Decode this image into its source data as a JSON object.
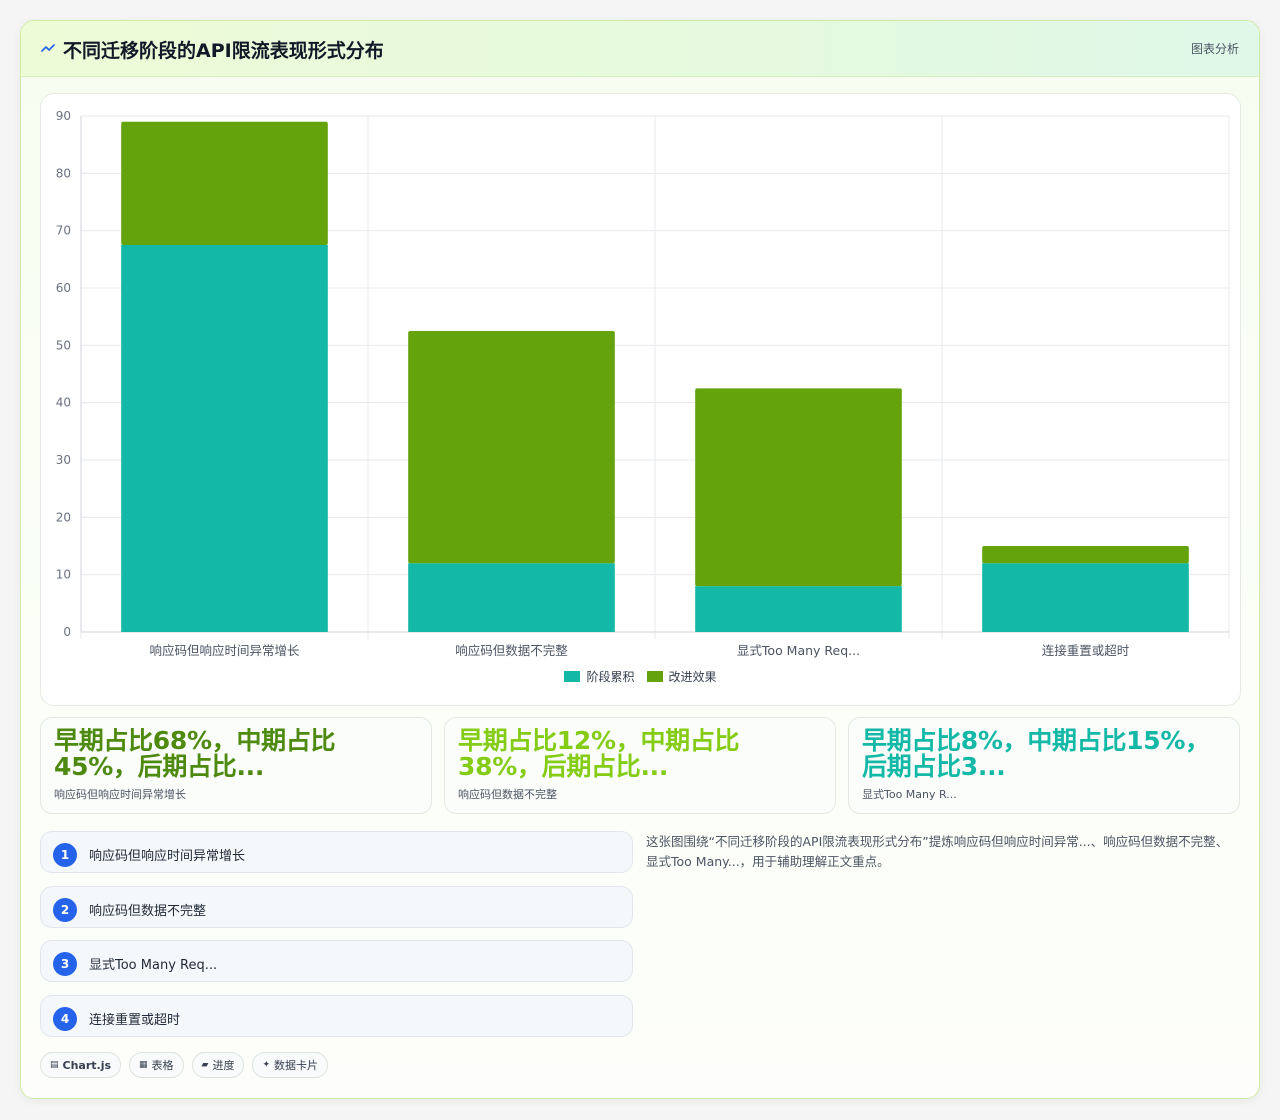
{
  "header": {
    "title": "不同迁移阶段的API限流表现形式分布",
    "right_label": "图表分析"
  },
  "chart_data": {
    "type": "bar",
    "stacked": true,
    "categories": [
      "响应码但响应时间异常增长",
      "响应码但数据不完整",
      "显式Too Many Req...",
      "连接重置或超时"
    ],
    "series": [
      {
        "name": "阶段累积",
        "values": [
          67.5,
          12,
          8,
          12
        ],
        "color": "#14b8a6"
      },
      {
        "name": "改进效果",
        "values": [
          21.5,
          40.5,
          34.5,
          3
        ],
        "color": "#65a30d"
      }
    ],
    "ylim": [
      0,
      90
    ],
    "yticks": [
      0,
      10,
      20,
      30,
      40,
      50,
      60,
      70,
      80,
      90
    ],
    "grid": true,
    "legend_position": "bottom"
  },
  "stats": [
    {
      "value": "早期占比68%，中期占比45%，后期占比...",
      "label": "响应码但响应时间异常增长",
      "color": "#4d8a0f"
    },
    {
      "value": "早期占比12%，中期占比38%，后期占比...",
      "label": "响应码但数据不完整",
      "color": "#84cc16"
    },
    {
      "value": "早期占比8%，中期占比15%，后期占比3...",
      "label": "显式Too Many R...",
      "color": "#14b8a6"
    }
  ],
  "list": [
    {
      "number": "1",
      "label": "响应码但响应时间异常增长"
    },
    {
      "number": "2",
      "label": "响应码但数据不完整"
    },
    {
      "number": "3",
      "label": "显式Too Many Req..."
    },
    {
      "number": "4",
      "label": "连接重置或超时"
    }
  ],
  "description": "这张图围绕“不同迁移阶段的API限流表现形式分布”提炼响应码但响应时间异常...、响应码但数据不完整、显式Too Many...，用于辅助理解正文重点。",
  "tags": [
    {
      "icon": "▤",
      "label": "Chart.js"
    },
    {
      "icon": "▦",
      "label": "表格"
    },
    {
      "icon": "▰",
      "label": "进度"
    },
    {
      "icon": "✦",
      "label": "数据卡片"
    }
  ]
}
